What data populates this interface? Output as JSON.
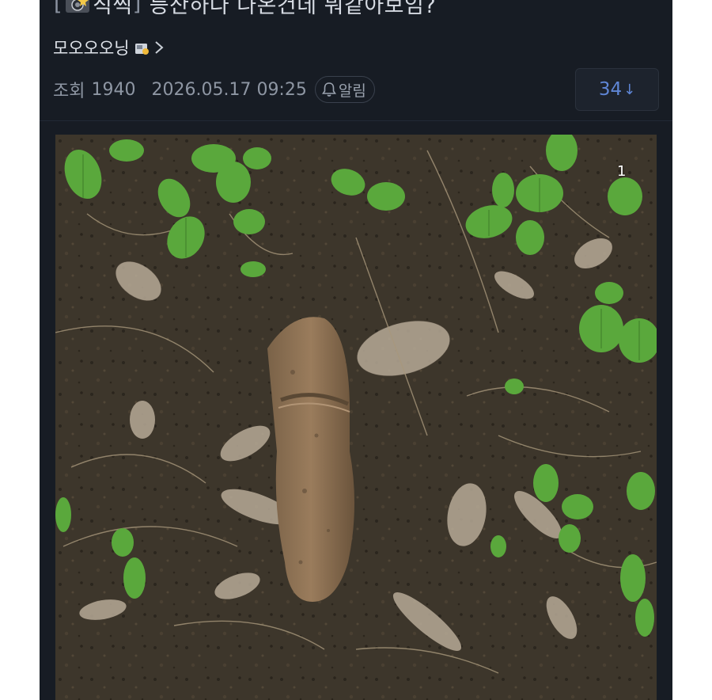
{
  "post": {
    "title_open": "[",
    "title_tag": "직찍",
    "title_close": "]",
    "title_text": "등산하다 나온건데 뭐같아보임?",
    "author": "모오오오닝",
    "views_label": "조회",
    "views": "1940",
    "datetime": "2026.05.17 09:25",
    "alarm_label": "알림",
    "reply_count": "34",
    "reply_arrow": "↓"
  },
  "photo": {
    "index_label": "1"
  },
  "icons": {
    "camera": "camera-icon",
    "badge": "badge-icon",
    "chevron": "chevron-right-icon",
    "bell": "bell-icon"
  },
  "colors": {
    "background": "#171c24",
    "text": "#dfe3ea",
    "meta_text": "#8e96a3",
    "accent": "#5f86d6"
  }
}
